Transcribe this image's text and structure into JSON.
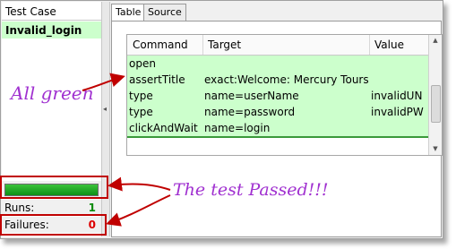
{
  "left_panel": {
    "header": "Test Case",
    "test_cases": [
      {
        "name": "Invalid_login",
        "status": "pass"
      }
    ],
    "progress": {
      "fraction": 1.0,
      "color": "#159c1e"
    },
    "runs": {
      "label": "Runs:",
      "value": "1"
    },
    "failures": {
      "label": "Failures:",
      "value": "0"
    }
  },
  "tabs": [
    {
      "label": "Table",
      "active": true
    },
    {
      "label": "Source",
      "active": false
    }
  ],
  "table": {
    "columns": [
      "Command",
      "Target",
      "Value"
    ],
    "rows": [
      {
        "command": "open",
        "target": "",
        "value": "",
        "status": "pass"
      },
      {
        "command": "assertTitle",
        "target": "exact:Welcome: Mercury Tours",
        "value": "",
        "status": "pass"
      },
      {
        "command": "type",
        "target": "name=userName",
        "value": "invalidUN",
        "status": "pass"
      },
      {
        "command": "type",
        "target": "name=password",
        "value": "invalidPW",
        "status": "pass"
      },
      {
        "command": "clickAndWait",
        "target": "name=login",
        "value": "",
        "status": "pass"
      }
    ],
    "pass_color": "#ccffcc"
  },
  "annotations": {
    "all_green": "All green",
    "test_passed": "The test Passed!!!",
    "color": "#a030d0",
    "box_color": "#c00000"
  }
}
